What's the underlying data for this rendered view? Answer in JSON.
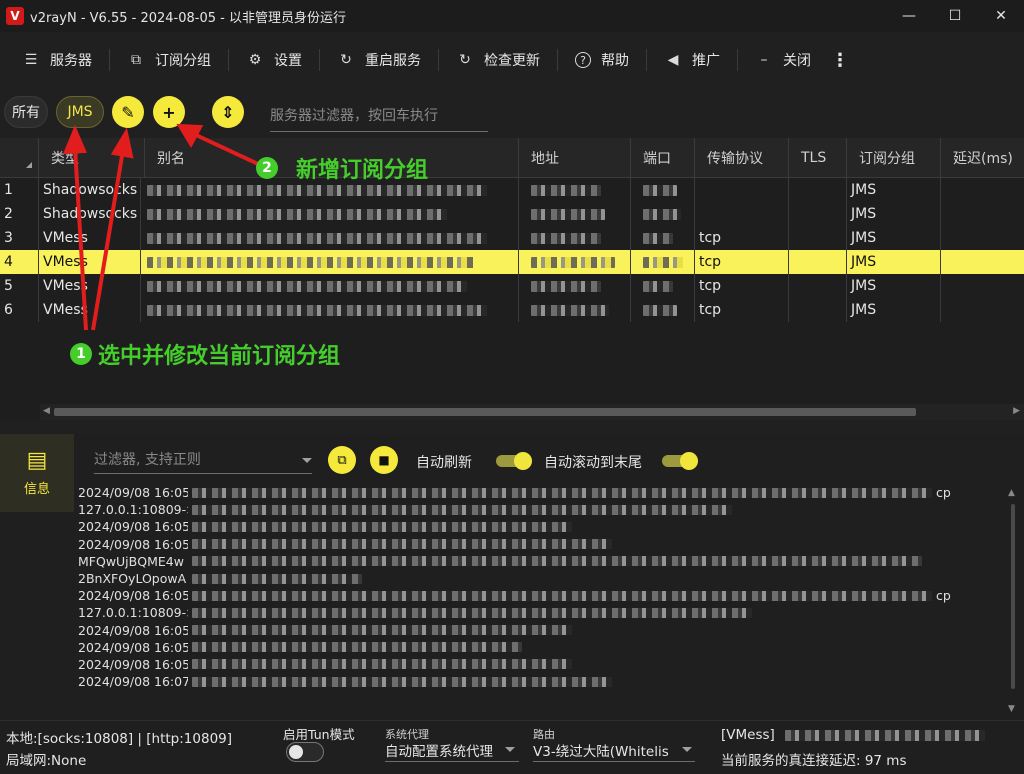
{
  "window": {
    "title": "v2rayN - V6.55 - 2024-08-05 - 以非管理员身份运行",
    "logo_letter": "V",
    "minimize": "—",
    "maximize": "☐",
    "close": "✕"
  },
  "menu": {
    "items": [
      {
        "key": "servers",
        "icon": "server-icon",
        "glyph": "☰",
        "label": "服务器"
      },
      {
        "key": "subscription",
        "icon": "subscription-icon",
        "glyph": "⧉",
        "label": "订阅分组"
      },
      {
        "key": "settings",
        "icon": "gear-icon",
        "glyph": "⚙",
        "label": "设置"
      },
      {
        "key": "restart",
        "icon": "restart-icon",
        "glyph": "↻",
        "label": "重启服务"
      },
      {
        "key": "update",
        "icon": "update-icon",
        "glyph": "↻",
        "label": "检查更新"
      },
      {
        "key": "help",
        "icon": "help-icon",
        "glyph": "?",
        "label": "帮助"
      },
      {
        "key": "promotion",
        "icon": "speaker-icon",
        "glyph": "◀",
        "label": "推广"
      },
      {
        "key": "close",
        "icon": "minus-icon",
        "glyph": "–",
        "label": "关闭"
      }
    ],
    "more": "⋮"
  },
  "groups": {
    "all_label": "所有",
    "jms_label": "JMS",
    "edit_glyph": "✎",
    "add_glyph": "+",
    "sort_glyph": "⇕",
    "filter_placeholder": "服务器过滤器，按回车执行"
  },
  "table": {
    "columns": [
      "类型",
      "别名",
      "地址",
      "端口",
      "传输协议",
      "TLS",
      "订阅分组",
      "延迟(ms)"
    ],
    "rows": [
      {
        "idx": "1",
        "type": "Shadowsocks",
        "transport": "",
        "group": "JMS",
        "selected": false
      },
      {
        "idx": "2",
        "type": "Shadowsocks",
        "transport": "",
        "group": "JMS",
        "selected": false
      },
      {
        "idx": "3",
        "type": "VMess",
        "transport": "tcp",
        "group": "JMS",
        "selected": false
      },
      {
        "idx": "4",
        "type": "VMess",
        "transport": "tcp",
        "group": "JMS",
        "selected": true
      },
      {
        "idx": "5",
        "type": "VMess",
        "transport": "tcp",
        "group": "JMS",
        "selected": false
      },
      {
        "idx": "6",
        "type": "VMess",
        "transport": "tcp",
        "group": "JMS",
        "selected": false
      }
    ]
  },
  "annotations": {
    "a1_num": "1",
    "a1_text": "选中并修改当前订阅分组",
    "a2_num": "2",
    "a2_text": "新增订阅分组",
    "color": "#45cd2c"
  },
  "log": {
    "tab_label": "信息",
    "filter_placeholder": "过滤器, 支持正则",
    "copy_glyph": "⧉",
    "clear_glyph": "🗑",
    "auto_refresh_label": "自动刷新",
    "auto_scroll_label": "自动滚动到末尾",
    "lines": [
      "2024/09/08 16:05",
      "127.0.0.1:10809->",
      "2024/09/08 16:05",
      "2024/09/08 16:05",
      "MFQwUjBQME4w",
      "2BnXFOyLOpowA",
      "2024/09/08 16:05",
      "127.0.0.1:10809->",
      "2024/09/08 16:05",
      "2024/09/08 16:05",
      "2024/09/08 16:05",
      "2024/09/08 16:07"
    ],
    "line_suffix_1": "cp",
    "line_suffix_7": "cp"
  },
  "status": {
    "local": "本地:[socks:10808] | [http:10809]",
    "lan": "局域网:None",
    "tun_label": "启用Tun模式",
    "sysproxy_caption": "系统代理",
    "sysproxy_value": "自动配置系统代理",
    "routing_caption": "路由",
    "routing_value": "V3-绕过大陆(Whitelis",
    "current_server_prefix": "[VMess]",
    "latency": "当前服务的真连接延迟: 97 ms"
  },
  "colors": {
    "accent": "#f5e93c",
    "selected_row": "#faf25a",
    "annotation": "#45cd2c",
    "brand": "#d11a1a"
  }
}
